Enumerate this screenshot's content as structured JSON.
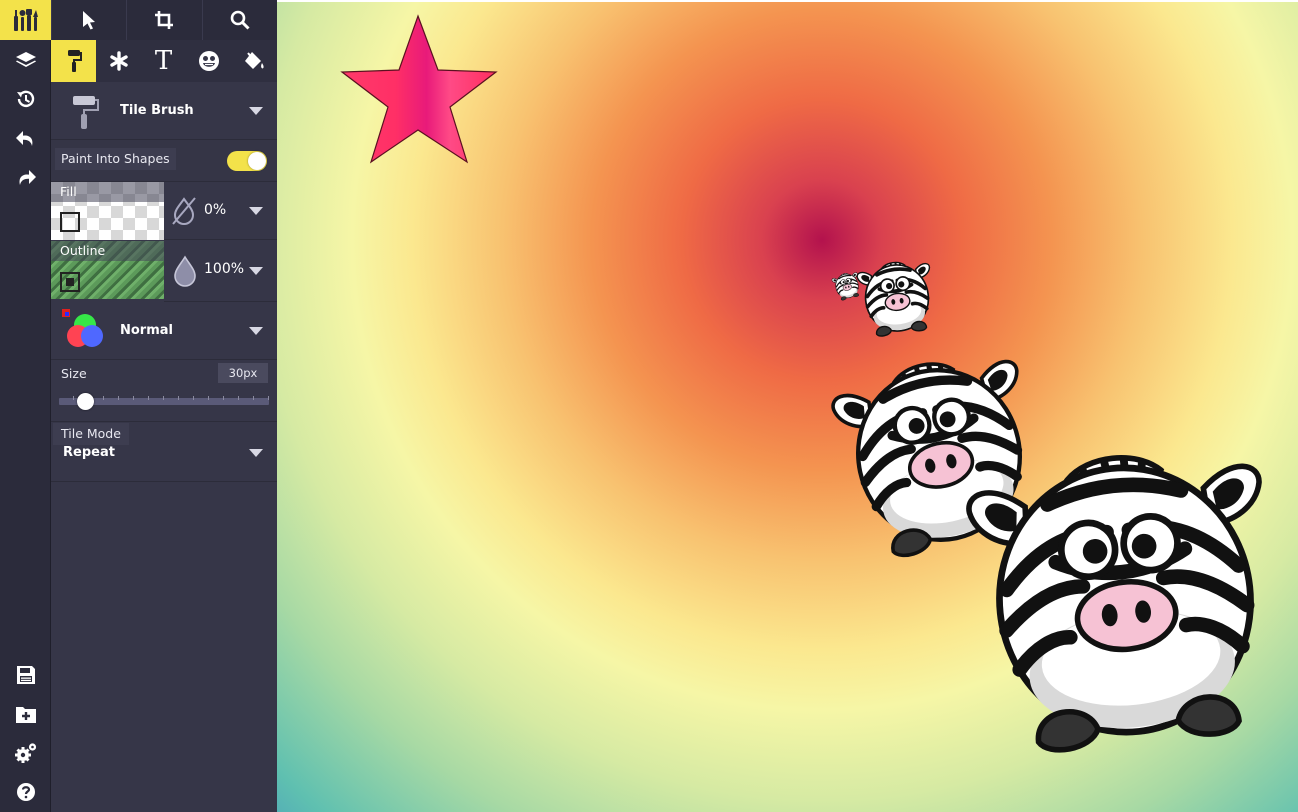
{
  "panel": {
    "brush": {
      "name": "Tile Brush"
    },
    "paint_into_shapes": {
      "label": "Paint Into Shapes",
      "enabled": true
    },
    "fill": {
      "label": "Fill",
      "opacity": "0%"
    },
    "outline": {
      "label": "Outline",
      "opacity": "100%"
    },
    "blend": {
      "mode": "Normal"
    },
    "size": {
      "label": "Size",
      "value": "30px",
      "slider_fraction": 0.05
    },
    "tile_mode": {
      "label": "Tile Mode",
      "value": "Repeat"
    }
  },
  "icons": {
    "rail": [
      "brushes-logo-icon",
      "layers-icon",
      "history-icon",
      "undo-icon",
      "redo-icon",
      "save-icon",
      "new-folder-icon",
      "settings-icon",
      "help-icon"
    ],
    "top_tools": [
      "select-arrow-icon",
      "crop-icon",
      "search-icon"
    ],
    "sub_tools": [
      "brush-icon",
      "asterisk-icon",
      "text-icon",
      "sticker-icon",
      "fill-bucket-icon"
    ]
  },
  "colors": {
    "accent": "#f3e24a",
    "panel": "#363648",
    "rail": "#2b2b3b"
  }
}
